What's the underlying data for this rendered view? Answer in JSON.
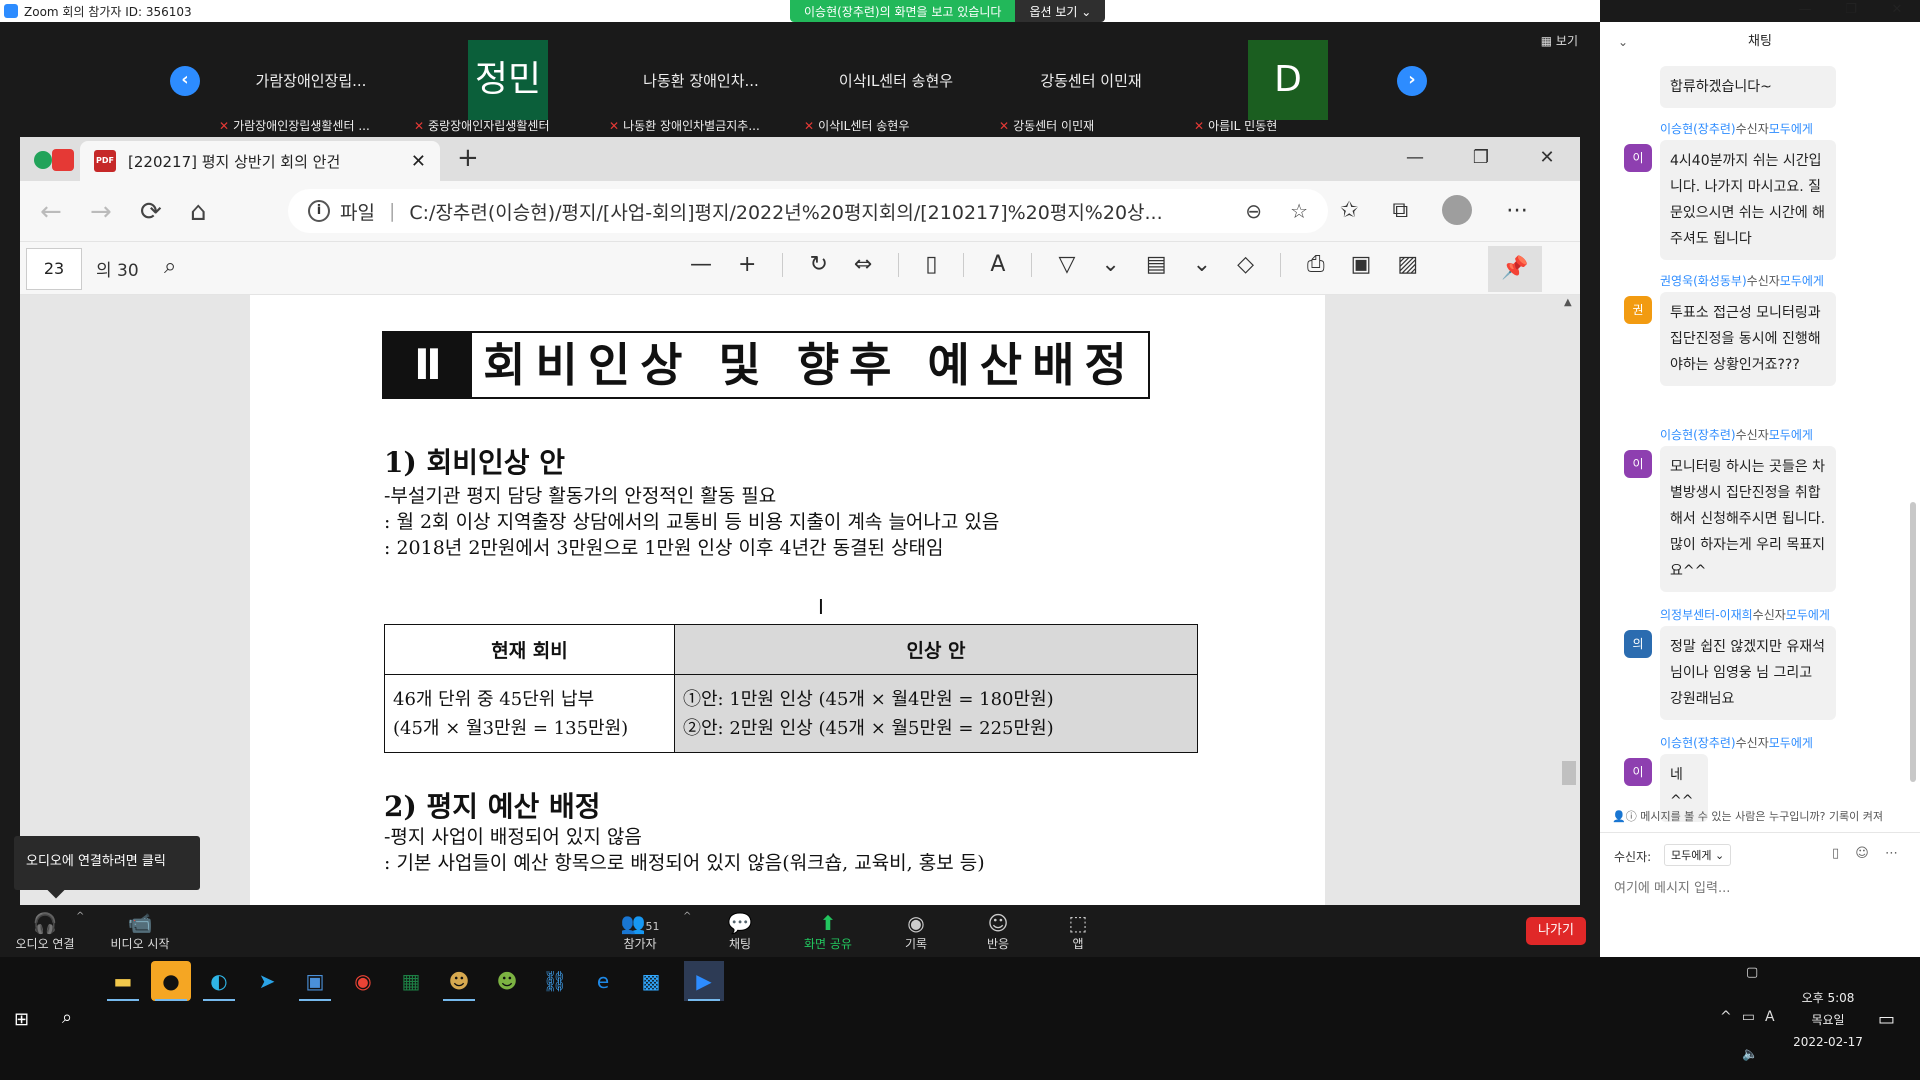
{
  "zoom": {
    "title": "Zoom 회의 참가자 ID: 356103",
    "share_banner": "이승현(장추련)의 화면을 보고 있습니다",
    "view_options": "옵션 보기 ⌄",
    "view_button": "▦ 보기",
    "window_controls": [
      "—",
      "❐",
      "✕"
    ],
    "thumbnails": [
      {
        "name": "가람장애인장립...",
        "label": "가람장애인장립생활센터 ..."
      },
      {
        "avatar": "정민",
        "avatar_color": "#0b5f3a",
        "label": "중랑장애인자립생활센터"
      },
      {
        "name": "나동환 장애인차...",
        "label": "나동환 장애인차별금지추..."
      },
      {
        "name": "이삭IL센터 송현우",
        "label": "이삭IL센터 송현우"
      },
      {
        "name": "강동센터 이민재",
        "label": "강동센터 이민재"
      },
      {
        "avatar": "D",
        "avatar_color": "#1b5e20",
        "label": "아름IL 민동현"
      }
    ],
    "controls": [
      {
        "label": "오디오 연결",
        "icon": "headphones-icon",
        "glyph": "🎧"
      },
      {
        "label": "비디오 시작",
        "icon": "video-off-icon",
        "glyph": "📹"
      },
      {
        "label": "참가자",
        "icon": "participants-icon",
        "glyph": "👥",
        "count": "51"
      },
      {
        "label": "채팅",
        "icon": "chat-icon",
        "glyph": "💬"
      },
      {
        "label": "화면 공유",
        "icon": "share-screen-icon",
        "glyph": "⬆"
      },
      {
        "label": "기록",
        "icon": "record-icon",
        "glyph": "◉"
      },
      {
        "label": "반응",
        "icon": "reaction-icon",
        "glyph": "☺"
      },
      {
        "label": "앱",
        "icon": "apps-icon",
        "glyph": "⬚"
      }
    ],
    "leave_button": "나가기",
    "audio_tooltip": "오디오에 연결하려면 클릭"
  },
  "browser": {
    "tab_title": "[220217] 평지 상반기 회의 안건",
    "pdf_icon_text": "PDF",
    "url_prefix": "파일",
    "url": "C:/장추련(이승현)/평지/[사업-회의]평지/2022년%20평지회의/[210217]%20평지%20상...",
    "page_current": "23",
    "page_total": "의 30"
  },
  "document": {
    "section_roman": "Ⅱ",
    "section_title": "회비인상 및 향후 예산배정",
    "sub1_title": "1) 회비인상 안",
    "sub1_lines": [
      "-부설기관 평지 담당 활동가의 안정적인 활동 필요",
      ": 월 2회 이상 지역출장 상담에서의 교통비 등 비용 지출이 계속 늘어나고 있음",
      ": 2018년 2만원에서 3만원으로 1만원 인상 이후 4년간 동결된 상태임"
    ],
    "table": {
      "headers": [
        "현재 회비",
        "인상 안"
      ],
      "current_lines": [
        "46개 단위 중 45단위 납부",
        "(45개 × 월3만원 = 135만원)"
      ],
      "proposal_lines": [
        "①안: 1만원 인상 (45개 × 월4만원 = 180만원)",
        "②안: 2만원 인상 (45개 × 월5만원 = 225만원)"
      ]
    },
    "sub2_title": "2) 평지 예산 배정",
    "sub2_lines": [
      "-평지 사업이 배정되어 있지 않음",
      ": 기본 사업들이 예산 항목으로 배정되어 있지 않음(워크숍, 교육비, 홍보 등)"
    ]
  },
  "chat": {
    "title": "채팅",
    "messages": [
      {
        "text": "합류하겠습니다~"
      },
      {
        "sender": "이승현(장추련)",
        "to_label": "수신자",
        "to": "모두에게",
        "avatar": "이",
        "avatar_color": "#8e3fb0",
        "text": "4시40분까지 쉬는 시간입니다. 나가지 마시고요. 질문있으시면 쉬는 시간에 해주셔도 됩니다"
      },
      {
        "sender": "권영욱(화성동부)",
        "to_label": "수신자",
        "to": "모두에게",
        "avatar": "권",
        "avatar_color": "#f29b11",
        "text": "투표소 접근성 모니터링과 집단진정을 동시에 진행해야하는 상황인거죠???"
      },
      {
        "sender": "이승현(장추련)",
        "to_label": "수신자",
        "to": "모두에게",
        "avatar": "이",
        "avatar_color": "#8e3fb0",
        "text": "모니터링 하시는 곳들은 차별방생시 집단진정을 취합해서 신청해주시면 됩니다. 많이 하자는게 우리 목표지요^^"
      },
      {
        "sender": "의정부센터-이재희",
        "to_label": "수신자",
        "to": "모두에게",
        "avatar": "의",
        "avatar_color": "#2b6cb0",
        "text": "정말 쉽진 않겠지만 유재석님이나 임영웅 님 그리고 강원래님요"
      },
      {
        "sender": "이승현(장추련)",
        "to_label": "수신자",
        "to": "모두에게",
        "avatar": "이",
        "avatar_color": "#8e3fb0",
        "text": "네^^"
      }
    ],
    "visibility_note": "메시지를 볼 수 있는 사람은 누구입니까? 기록이 켜져",
    "recipient_label": "수신자:",
    "recipient_value": "모두에게 ⌄",
    "input_placeholder": "여기에 메시지 입력..."
  },
  "taskbar": {
    "time_ampm": "오후 5:08",
    "weekday": "목요일",
    "date": "2022-02-17",
    "ime": "A"
  }
}
